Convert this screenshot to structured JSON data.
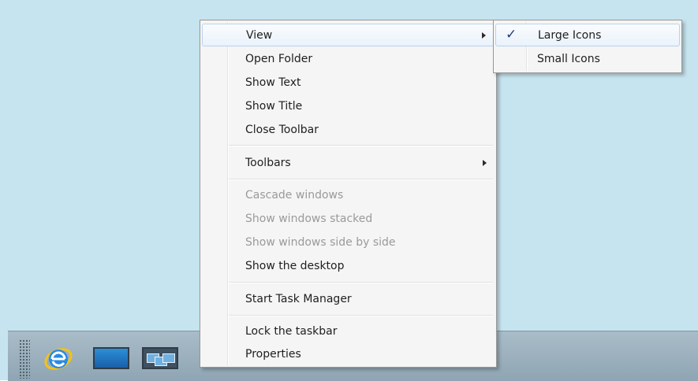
{
  "menu": {
    "view": "View",
    "open_folder": "Open Folder",
    "show_text": "Show Text",
    "show_title": "Show Title",
    "close_toolbar": "Close Toolbar",
    "toolbars": "Toolbars",
    "cascade_windows": "Cascade windows",
    "show_windows_stacked": "Show windows stacked",
    "show_windows_side_by_side": "Show windows side by side",
    "show_the_desktop": "Show the desktop",
    "start_task_manager": "Start Task Manager",
    "lock_the_taskbar": "Lock the taskbar",
    "properties": "Properties"
  },
  "submenu": {
    "large_icons": "Large Icons",
    "small_icons": "Small Icons",
    "checked": "✓"
  },
  "taskbar": {
    "icons": [
      "internet-explorer-icon",
      "show-desktop-icon",
      "switch-windows-icon"
    ]
  },
  "colors": {
    "desktop": "#c6e4ef",
    "taskbar": "#9fb3bf",
    "highlight_border": "#b9d2ee",
    "disabled_text": "#9a9a9a"
  }
}
